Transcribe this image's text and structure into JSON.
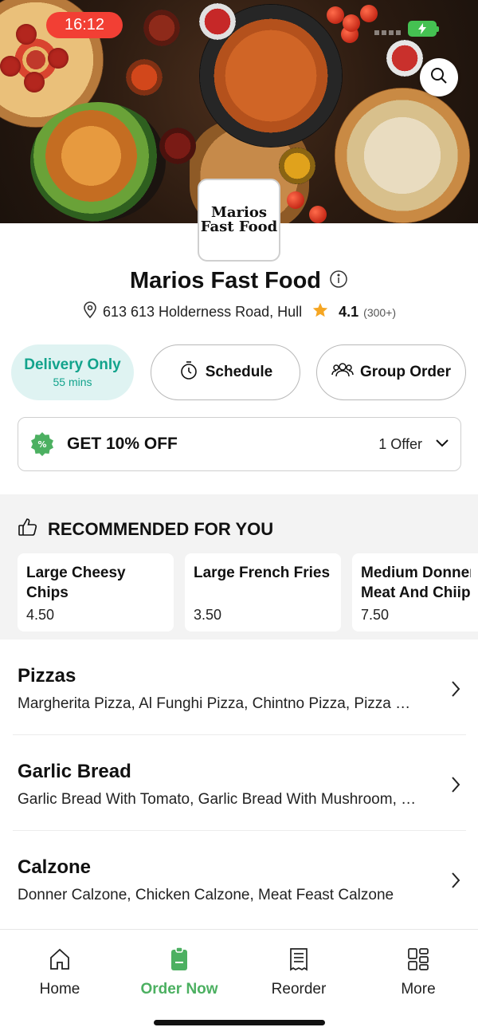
{
  "status_bar": {
    "time": "16:12"
  },
  "restaurant": {
    "logo_line1": "Marios",
    "logo_line2": "Fast Food",
    "name": "Marios Fast Food",
    "address": "613 613 Holderness Road, Hull",
    "rating": "4.1",
    "rating_count": "(300+)"
  },
  "options": {
    "delivery_label": "Delivery Only",
    "delivery_time": "55 mins",
    "schedule_label": "Schedule",
    "group_label": "Group Order"
  },
  "offer": {
    "title": "GET 10% OFF",
    "count": "1 Offer"
  },
  "recommended": {
    "heading": "RECOMMENDED FOR YOU",
    "items": [
      {
        "name_line1": "Large Cheesy",
        "name_line2": "Chips",
        "price": "4.50"
      },
      {
        "name_line1": "Large French Fries",
        "name_line2": "",
        "price": "3.50"
      },
      {
        "name_line1": "Medium Donner",
        "name_line2": "Meat And Chiips",
        "price": "7.50"
      }
    ]
  },
  "categories": [
    {
      "title": "Pizzas",
      "desc": "Margherita Pizza, Al Funghi Pizza, Chintno Pizza, Pizza Hot Chilli, Pizza Vegetarian"
    },
    {
      "title": "Garlic Bread",
      "desc": "Garlic Bread With Tomato, Garlic Bread With Mushroom, Garlic Bread With Cheese"
    },
    {
      "title": "Calzone",
      "desc": "Donner Calzone, Chicken Calzone, Meat Feast Calzone"
    }
  ],
  "nav": {
    "home": "Home",
    "order_now": "Order Now",
    "reorder": "Reorder",
    "more": "More"
  },
  "colors": {
    "accent_green": "#4cb061",
    "delivery_teal": "#12a38c",
    "star": "#f5a623",
    "time_pill": "#f23f34"
  },
  "icons": [
    "search-icon",
    "info-icon",
    "location-pin-icon",
    "star-icon",
    "stopwatch-icon",
    "group-icon",
    "discount-badge-icon",
    "chevron-down-icon",
    "thumbs-up-icon",
    "chevron-right-icon",
    "home-icon",
    "order-icon",
    "receipt-icon",
    "grid-icon",
    "battery-icon"
  ]
}
